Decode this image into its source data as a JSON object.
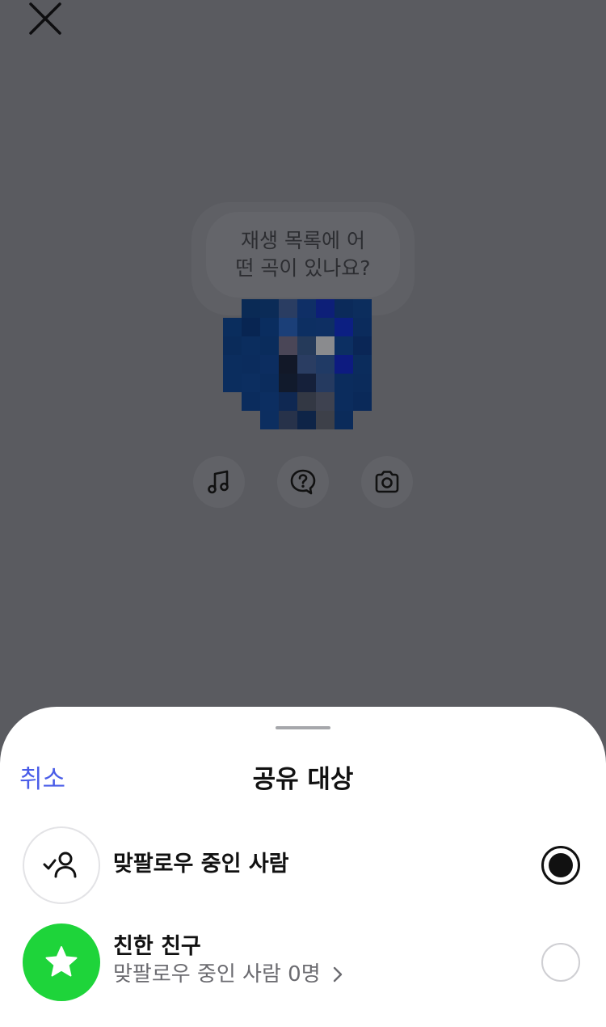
{
  "background": {
    "prompt_line1": "재생 목록에 어",
    "prompt_line2": "떤 곡이 있나요?",
    "tools": [
      {
        "icon": "music-note-icon"
      },
      {
        "icon": "question-bubble-icon"
      },
      {
        "icon": "camera-icon"
      }
    ]
  },
  "sheet": {
    "cancel_label": "취소",
    "title": "공유 대상",
    "options": [
      {
        "title": "맞팔로우 중인 사람",
        "selected": true,
        "icon": "person-check-icon"
      },
      {
        "title": "친한 친구",
        "subtitle": "맞팔로우 중인 사람 0명",
        "selected": false,
        "icon": "star-icon"
      }
    ]
  },
  "colors": {
    "accent": "#4a5de8",
    "close_friends_green": "#1ed43a",
    "backdrop": "#5a5b60"
  }
}
